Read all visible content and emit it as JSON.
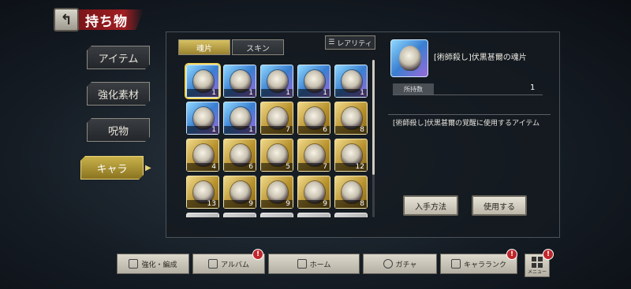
{
  "header": {
    "title": "持ち物",
    "back_icon": "back-arrow-icon"
  },
  "categories": [
    {
      "label": "アイテム",
      "active": false
    },
    {
      "label": "強化素材",
      "active": false
    },
    {
      "label": "呪物",
      "active": false
    },
    {
      "label": "キャラ",
      "active": true
    }
  ],
  "tabs": {
    "soul": "魂片",
    "skin": "スキン"
  },
  "sort": {
    "label": "レアリティ"
  },
  "grid": {
    "items": [
      {
        "count": "1",
        "rarity": "blue"
      },
      {
        "count": "1",
        "rarity": "blue"
      },
      {
        "count": "1",
        "rarity": "blue"
      },
      {
        "count": "1",
        "rarity": "blue"
      },
      {
        "count": "1",
        "rarity": "blue"
      },
      {
        "count": "1",
        "rarity": "blue"
      },
      {
        "count": "1",
        "rarity": "blue"
      },
      {
        "count": "7",
        "rarity": "gold"
      },
      {
        "count": "6",
        "rarity": "gold"
      },
      {
        "count": "8",
        "rarity": "gold"
      },
      {
        "count": "4",
        "rarity": "gold"
      },
      {
        "count": "6",
        "rarity": "gold"
      },
      {
        "count": "5",
        "rarity": "gold"
      },
      {
        "count": "7",
        "rarity": "gold"
      },
      {
        "count": "12",
        "rarity": "gold"
      },
      {
        "count": "13",
        "rarity": "gold"
      },
      {
        "count": "9",
        "rarity": "gold"
      },
      {
        "count": "9",
        "rarity": "gold"
      },
      {
        "count": "9",
        "rarity": "gold"
      },
      {
        "count": "8",
        "rarity": "gold"
      }
    ]
  },
  "detail": {
    "name": "[術師殺し]伏黒甚爾の魂片",
    "count_label": "所持数",
    "count_value": "1",
    "description": "[術師殺し]伏黒甚爾の覚醒に使用するアイテム",
    "obtain_button": "入手方法",
    "use_button": "使用する"
  },
  "nav": [
    {
      "label": "強化・編成",
      "badge": false
    },
    {
      "label": "アルバム",
      "badge": true
    },
    {
      "label": "ホーム",
      "badge": false
    },
    {
      "label": "ガチャ",
      "badge": false
    },
    {
      "label": "キャラランク",
      "badge": true
    }
  ],
  "menu": {
    "label": "メニュー",
    "badge": true
  },
  "colors": {
    "accent": "#c9b24a",
    "title_band": "#a01e22",
    "badge": "#c0262b"
  }
}
